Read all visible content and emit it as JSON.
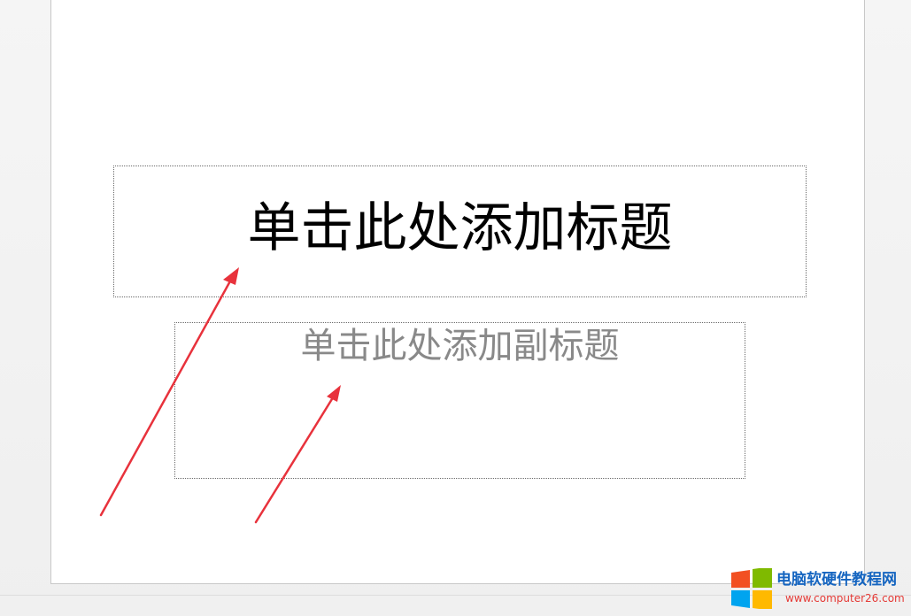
{
  "slide": {
    "title_placeholder": "单击此处添加标题",
    "subtitle_placeholder": "单击此处添加副标题"
  },
  "annotations": {
    "arrow_color": "#e8323c",
    "arrow_count": 2
  },
  "watermark": {
    "title": "电脑软硬件教程网",
    "url": "www.computer26.com",
    "logo": "windows-logo-icon",
    "logo_colors": [
      "#f25022",
      "#7fba00",
      "#00a4ef",
      "#ffb900"
    ]
  },
  "colors": {
    "title_text": "#000000",
    "subtitle_text": "#898989",
    "placeholder_border": "#6a6a6a",
    "slide_background": "#ffffff",
    "workspace_background": "#f2f2f2"
  }
}
